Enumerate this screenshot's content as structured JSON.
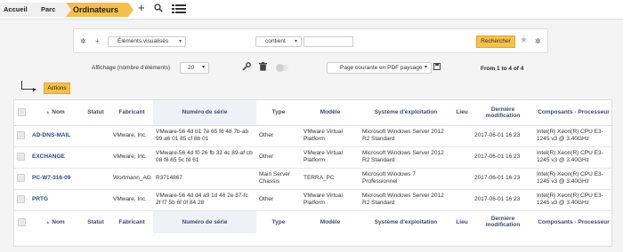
{
  "breadcrumb": [
    "Accueil",
    "Parc",
    "Ordinateurs"
  ],
  "toolbar_icons": [
    "add-icon",
    "search-icon",
    "list-icon"
  ],
  "search": {
    "criteria_field": "Éléments visualisés",
    "operator": "contient",
    "value": "",
    "search_button": "Rechercher"
  },
  "display": {
    "label": "Affichage (nombre d'éléments)",
    "per_page": "20",
    "export_option": "Page courante en PDF paysage",
    "pagination": "From 1 to 4 of 4"
  },
  "actions_label": "Actions",
  "table": {
    "columns": [
      "Nom",
      "Statut",
      "Fabricant",
      "Numéro de série",
      "Type",
      "Modèle",
      "Système d'exploitation",
      "Lieu",
      "Dernière modification",
      "Composants - Processeur"
    ],
    "rows": [
      {
        "nom": "AD-DNS-MAIL",
        "statut": "",
        "fabricant": "VMware, Inc.",
        "serie": "VMware-56 4d b1 7e 65 f6 48 7b-ab 99 a6 01 85 cf 8b 01",
        "type": "Other",
        "modele": "VMware Virtual Platform",
        "os": "Microsoft Windows Server 2012 R2 Standard",
        "lieu": "",
        "modif": "2017-06-01 16:23",
        "cpu": "Intel(R) Xeon(R) CPU E3-1245 v3 @ 3.40GHz"
      },
      {
        "nom": "EXCHANGE",
        "statut": "",
        "fabricant": "VMware, Inc.",
        "serie": "VMware-56 4d f0 26 fb 33 4c 89-af cb 08 f8 65 5c fd 61",
        "type": "Other",
        "modele": "VMware Virtual Platform",
        "os": "Microsoft Windows Server 2012 R2 Standard",
        "lieu": "",
        "modif": "2017-06-01 16:23",
        "cpu": "Intel(R) Xeon(R) CPU E3-1245 v3 @ 3.40GHz"
      },
      {
        "nom": "PC-W7-316-09",
        "statut": "",
        "fabricant": "Wortmann_AG",
        "serie": "R3714867",
        "type": "Main Server Chassis",
        "modele": "TERRA_PC",
        "os": "Microsoft Windows 7 Professionnel",
        "lieu": "",
        "modif": "2017-06-01 16:23",
        "cpu": "Intel(R) Xeon(R) CPU E3-1245 v3 @ 3.40GHz"
      },
      {
        "nom": "PRTG",
        "statut": "",
        "fabricant": "VMware, Inc.",
        "serie": "VMware-56 4d d4 a9 1d 46 2e 87-fc 2f f7 5b 6f 0f 84 28",
        "type": "Other",
        "modele": "VMware Virtual Platform",
        "os": "Microsoft Windows Server 2012 R2 Standard",
        "lieu": "",
        "modif": "2017-06-01 16:23",
        "cpu": "Intel(R) Xeon(R) CPU E3-1245 v3 @ 3.40GHz"
      }
    ]
  },
  "colors": {
    "accent": "#f5c04a",
    "link": "#2b4a8a",
    "header_text": "#3a4b6e"
  }
}
